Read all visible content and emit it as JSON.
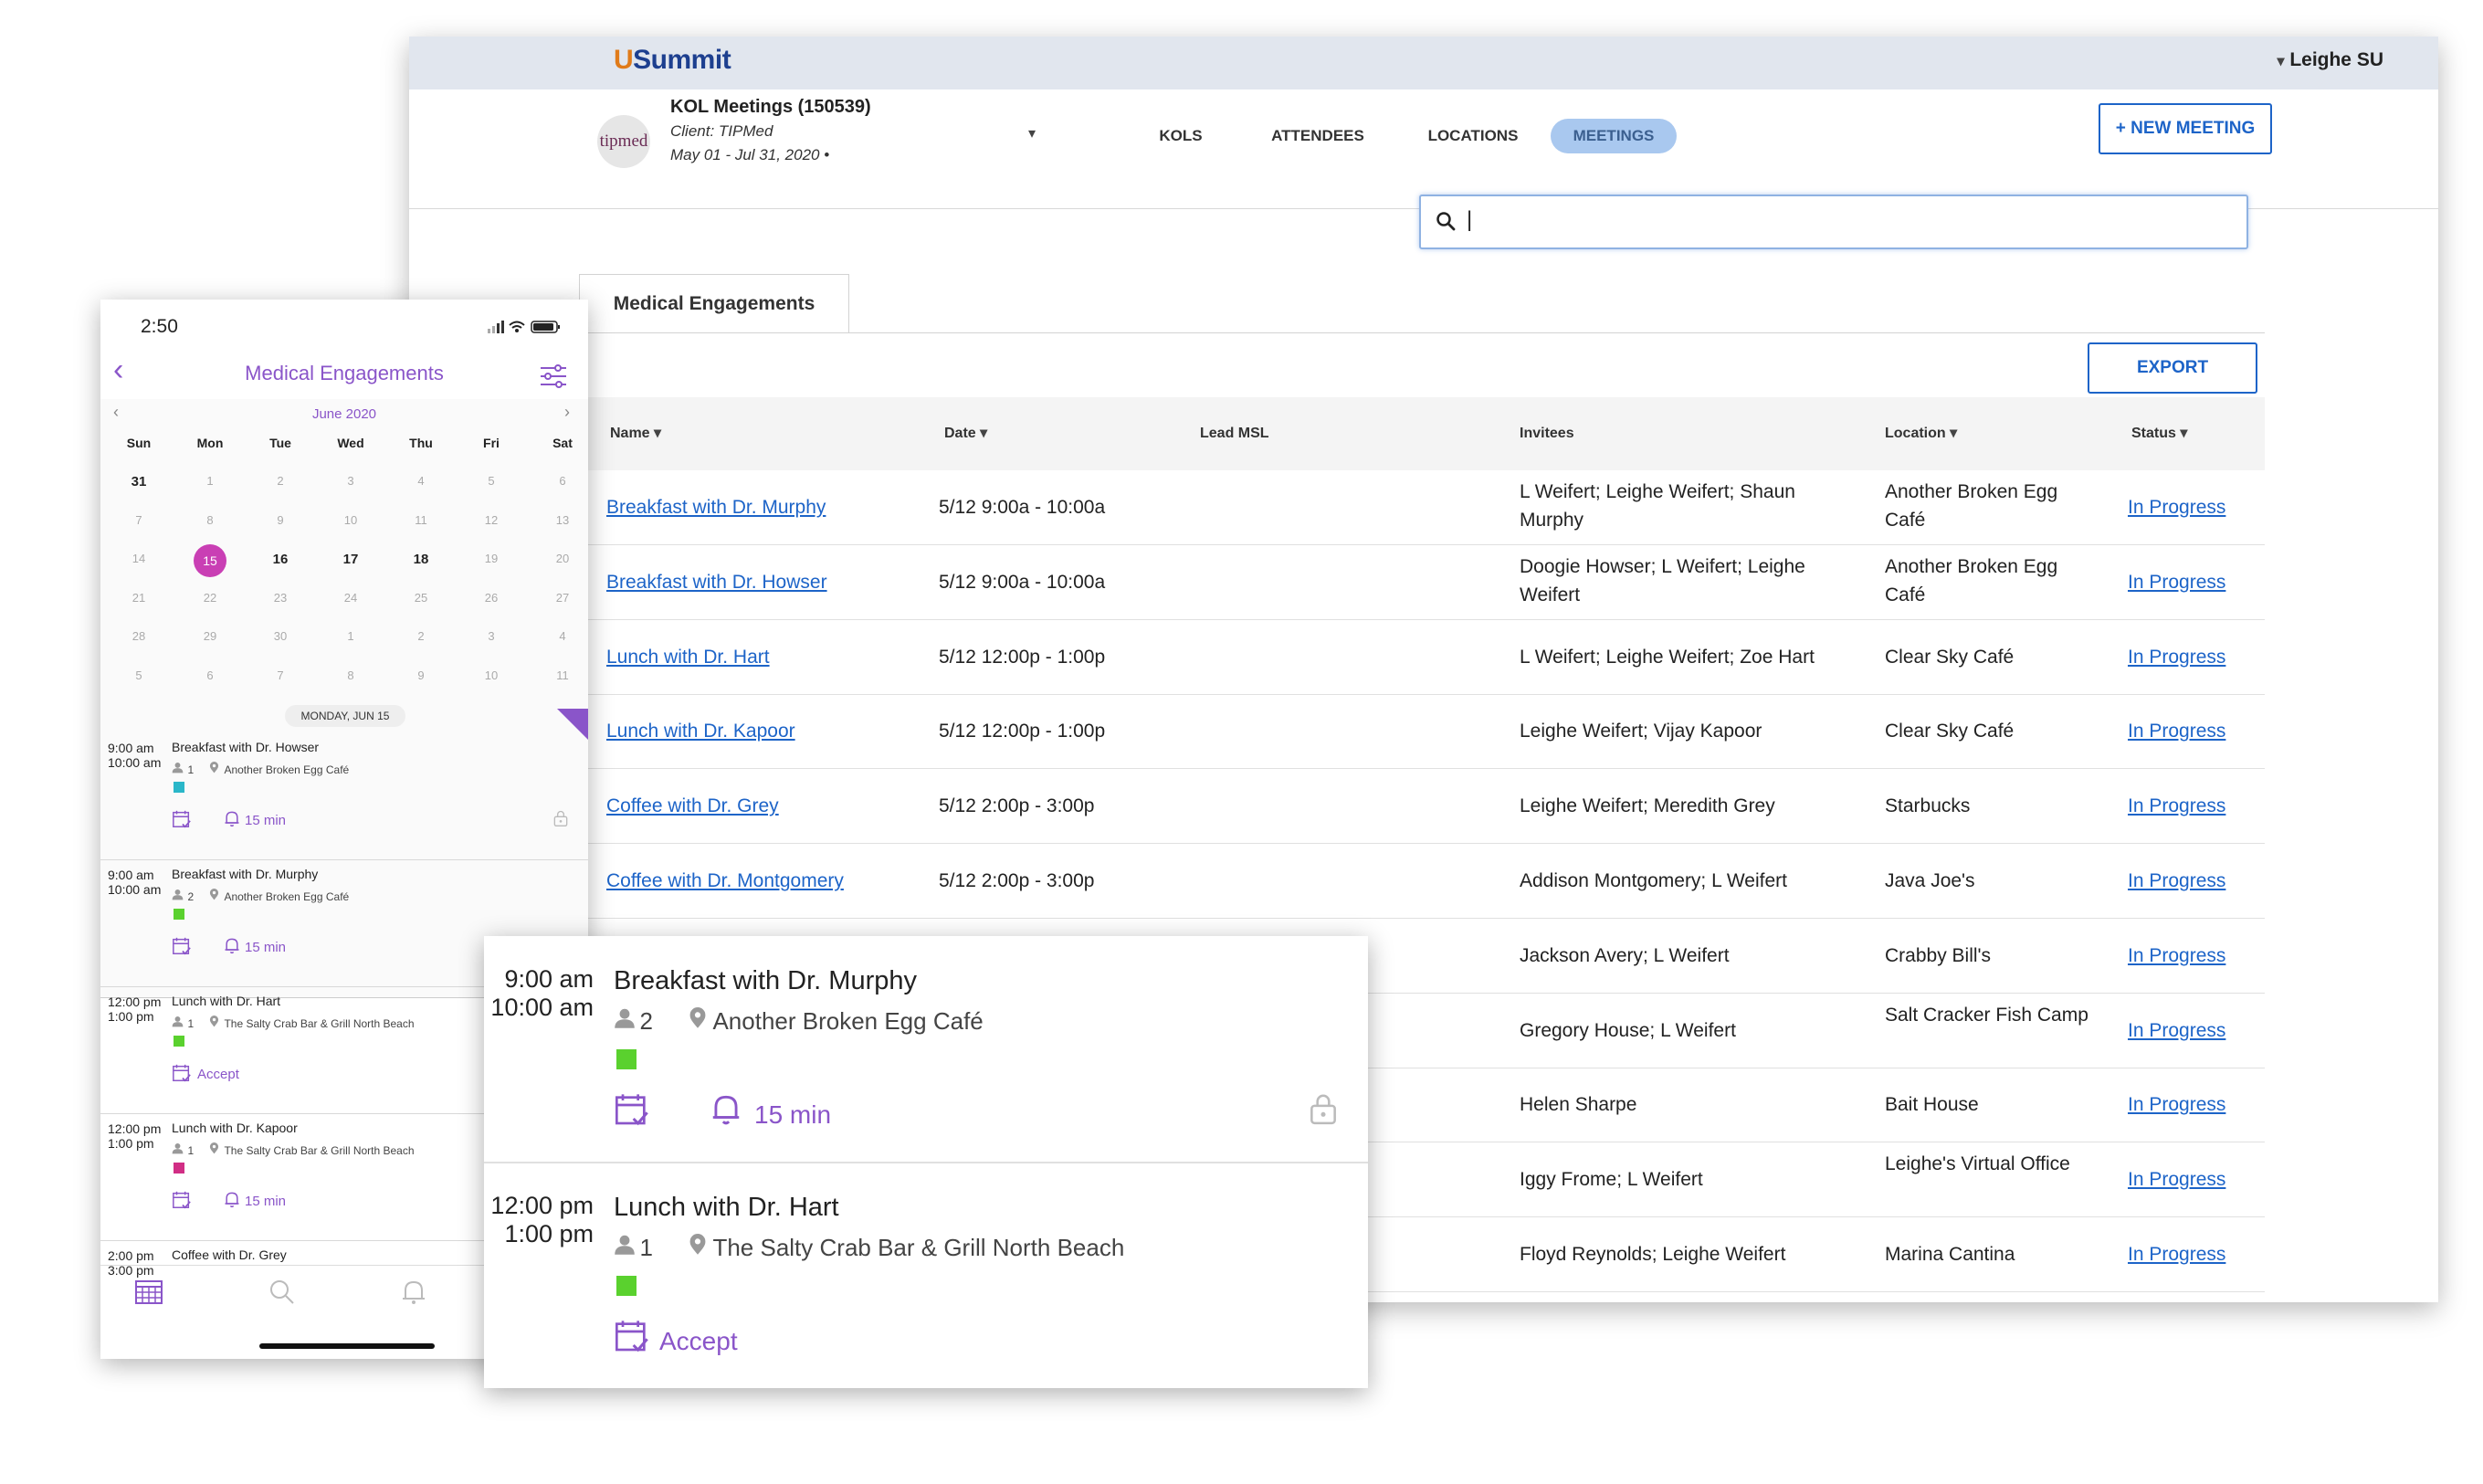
{
  "desktop": {
    "logo": "Summit",
    "logo_prefix": "U",
    "user_name": "Leighe SU",
    "avatar_text": "tipmed",
    "project_title": "KOL Meetings (150539)",
    "client": "Client: TIPMed",
    "date_range": "May 01 - Jul 31, 2020 •",
    "nav_tabs": [
      "KOLS",
      "ATTENDEES",
      "LOCATIONS",
      "MEETINGS"
    ],
    "new_meeting_label": "+ NEW MEETING",
    "search_value": "|",
    "section_tab": "Medical Engagements",
    "export_label": "EXPORT",
    "columns": [
      "Name",
      "Date",
      "Lead MSL",
      "Invitees",
      "Location",
      "Status"
    ],
    "rows": [
      {
        "name": "Breakfast with Dr. Murphy",
        "date": "5/12 9:00a - 10:00a",
        "invitees": "L Weifert; Leighe Weifert; Shaun Murphy",
        "location": "Another Broken Egg Café",
        "status": "In Progress"
      },
      {
        "name": "Breakfast with Dr. Howser",
        "date": "5/12 9:00a - 10:00a",
        "invitees": "Doogie Howser; L Weifert; Leighe Weifert",
        "location": "Another Broken Egg Café",
        "status": "In Progress"
      },
      {
        "name": "Lunch with Dr. Hart",
        "date": "5/12 12:00p - 1:00p",
        "invitees": "L Weifert; Leighe Weifert; Zoe Hart",
        "location": "Clear Sky Café",
        "status": "In Progress"
      },
      {
        "name": "Lunch with Dr. Kapoor",
        "date": "5/12 12:00p - 1:00p",
        "invitees": "Leighe Weifert; Vijay Kapoor",
        "location": "Clear Sky Café",
        "status": "In Progress"
      },
      {
        "name": "Coffee with Dr. Grey",
        "date": "5/12 2:00p - 3:00p",
        "invitees": "Leighe Weifert; Meredith Grey",
        "location": "Starbucks",
        "status": "In Progress"
      },
      {
        "name": "Coffee with Dr. Montgomery",
        "date": "5/12 2:00p - 3:00p",
        "invitees": "Addison Montgomery; L Weifert",
        "location": "Java Joe's",
        "status": "In Progress"
      },
      {
        "name": "",
        "date": "",
        "invitees": "Jackson Avery; L Weifert",
        "location": "Crabby Bill's",
        "status": "In Progress"
      },
      {
        "name": "",
        "date": "",
        "invitees": "Gregory House; L Weifert",
        "location": "Salt Cracker Fish Camp",
        "status": "In Progress"
      },
      {
        "name": "",
        "date": "",
        "invitees": "Helen Sharpe",
        "location": "Bait House",
        "status": "In Progress"
      },
      {
        "name": "",
        "date": "",
        "invitees": "Iggy Frome; L Weifert",
        "location": "Leighe's Virtual Office",
        "status": "In Progress"
      },
      {
        "name": "",
        "date": "",
        "invitees": "Floyd Reynolds; Leighe Weifert",
        "location": "Marina Cantina",
        "status": "In Progress"
      }
    ]
  },
  "phone": {
    "clock": "2:50",
    "title": "Medical Engagements",
    "month": "June 2020",
    "weekdays": [
      "Sun",
      "Mon",
      "Tue",
      "Wed",
      "Thu",
      "Fri",
      "Sat"
    ],
    "weeks": [
      [
        "31",
        "1",
        "2",
        "3",
        "4",
        "5",
        "6"
      ],
      [
        "7",
        "8",
        "9",
        "10",
        "11",
        "12",
        "13"
      ],
      [
        "14",
        "15",
        "16",
        "17",
        "18",
        "19",
        "20"
      ],
      [
        "21",
        "22",
        "23",
        "24",
        "25",
        "26",
        "27"
      ],
      [
        "28",
        "29",
        "30",
        "1",
        "2",
        "3",
        "4"
      ],
      [
        "5",
        "6",
        "7",
        "8",
        "9",
        "10",
        "11"
      ]
    ],
    "day_header": "MONDAY, JUN 15",
    "events": [
      {
        "start": "9:00 am",
        "end": "10:00 am",
        "title": "Breakfast with Dr. Howser",
        "count": "1",
        "location": "Another Broken Egg Café",
        "color": "#2ab7c9",
        "action": "15 min"
      },
      {
        "start": "9:00 am",
        "end": "10:00 am",
        "title": "Breakfast with Dr. Murphy",
        "count": "2",
        "location": "Another Broken Egg Café",
        "color": "#5ad12e",
        "action": "15 min"
      },
      {
        "start": "12:00 pm",
        "end": "1:00 pm",
        "title": "Lunch with Dr. Hart",
        "count": "1",
        "location": "The Salty Crab Bar & Grill North Beach",
        "color": "#5ad12e",
        "action": "Accept"
      },
      {
        "start": "12:00 pm",
        "end": "1:00 pm",
        "title": "Lunch with Dr. Kapoor",
        "count": "1",
        "location": "The Salty Crab Bar & Grill North Beach",
        "color": "#d12e85",
        "action": "15 min"
      },
      {
        "start": "2:00 pm",
        "end": "3:00 pm",
        "title": "Coffee with Dr. Grey",
        "count": "",
        "location": "",
        "color": "",
        "action": ""
      }
    ]
  },
  "zoom": {
    "events": [
      {
        "start": "9:00 am",
        "end": "10:00 am",
        "title": "Breakfast with Dr. Murphy",
        "count": "2",
        "location": "Another Broken Egg Café",
        "color": "#5ad12e",
        "action": "15 min"
      },
      {
        "start": "12:00 pm",
        "end": "1:00 pm",
        "title": "Lunch with Dr. Hart",
        "count": "1",
        "location": "The Salty Crab Bar & Grill North Beach",
        "color": "#5ad12e",
        "action": "Accept"
      }
    ]
  },
  "colors": {
    "brand_blue": "#1d64c8",
    "accent_purple": "#8a55c9",
    "selected_day": "#c93fb4",
    "meetings_tab": "#a9c8ef"
  },
  "icons": [
    "search-icon",
    "chevron-down-icon",
    "back-arrow-icon",
    "filter-icon",
    "person-icon",
    "pin-icon",
    "calendar-check-icon",
    "bell-icon",
    "lock-icon",
    "calendar-icon"
  ]
}
